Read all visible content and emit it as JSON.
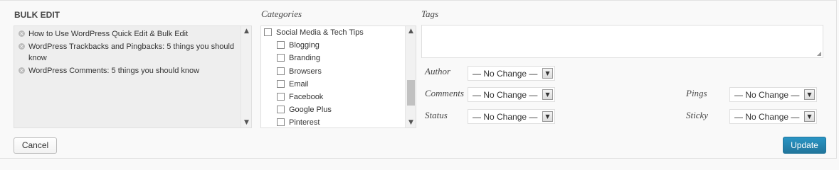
{
  "bulk_edit": {
    "title": "BULK EDIT",
    "posts": [
      "How to Use WordPress Quick Edit & Bulk Edit",
      "WordPress Trackbacks and Pingbacks: 5 things you should know",
      "WordPress Comments: 5 things you should know"
    ]
  },
  "categories": {
    "label": "Categories",
    "items": [
      {
        "label": "Social Media & Tech Tips",
        "checked": false,
        "level": 0
      },
      {
        "label": "Blogging",
        "checked": false,
        "level": 1
      },
      {
        "label": "Branding",
        "checked": false,
        "level": 1
      },
      {
        "label": "Browsers",
        "checked": false,
        "level": 1
      },
      {
        "label": "Email",
        "checked": false,
        "level": 1
      },
      {
        "label": "Facebook",
        "checked": false,
        "level": 1
      },
      {
        "label": "Google Plus",
        "checked": false,
        "level": 1
      },
      {
        "label": "Pinterest",
        "checked": false,
        "level": 1
      }
    ]
  },
  "tags": {
    "label": "Tags",
    "value": ""
  },
  "fields": {
    "author": {
      "label": "Author",
      "value": "— No Change —"
    },
    "comments": {
      "label": "Comments",
      "value": "— No Change —"
    },
    "status": {
      "label": "Status",
      "value": "— No Change —"
    },
    "pings": {
      "label": "Pings",
      "value": "— No Change —"
    },
    "sticky": {
      "label": "Sticky",
      "value": "— No Change —"
    }
  },
  "actions": {
    "cancel": "Cancel",
    "update": "Update"
  },
  "colors": {
    "primary": "#21759b",
    "panel_bg": "#f9f9f9"
  },
  "icons": {
    "remove": "remove-circle-icon",
    "dropdown": "chevron-down-icon",
    "resize": "resize-grip-icon"
  }
}
